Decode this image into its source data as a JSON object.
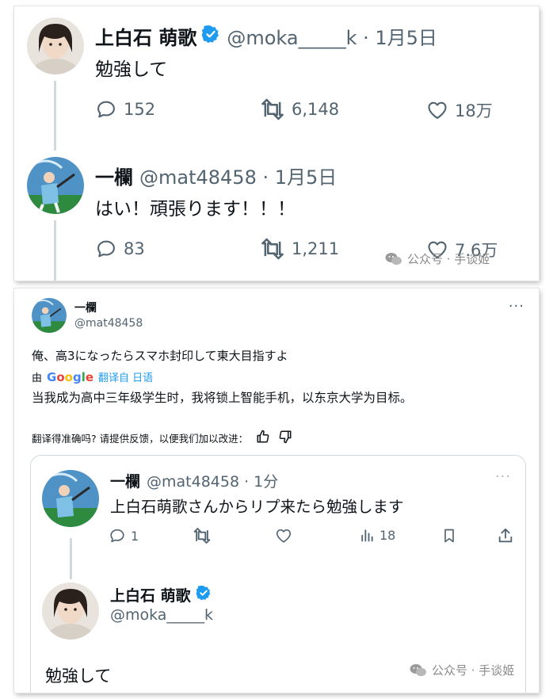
{
  "top_card": {
    "tweet1": {
      "name": "上白石 萌歌",
      "meta": "@moka_____k · 1月5日",
      "text": "勉強して",
      "replies": "152",
      "retweets": "6,148",
      "likes": "18万"
    },
    "tweet2": {
      "name": "一欄",
      "meta": "@mat48458 · 1月5日",
      "text": "はい！頑張ります！！！",
      "replies": "83",
      "retweets": "1,211",
      "likes": "7.6万"
    },
    "watermark": "公众号 · 手谈姬"
  },
  "bottom_card": {
    "name": "一欄",
    "handle": "@mat48458",
    "more": "···",
    "text": "俺、高3になったらスマホ封印して東大目指すよ",
    "by_prefix": "由",
    "google": {
      "G": "G",
      "o1": "o",
      "o2": "o",
      "g": "g",
      "l": "l",
      "e": "e"
    },
    "translated_from": "翻译自 日语",
    "translation": "当我成为高中三年级学生时，我将锁上智能手机，以东京大学为目标。",
    "feedback_prompt": "翻译得准确吗? 请提供反馈，以便我们加以改进：",
    "quote": {
      "name": "一欄",
      "meta": "@mat48458 · 1分",
      "more": "···",
      "text": "上白石萌歌さんからリプ来たら勉強します",
      "replies": "1",
      "views": "18",
      "reply_name": "上白石 萌歌",
      "reply_handle": "@moka_____k",
      "reply_text": "勉強して"
    },
    "watermark": "公众号 · 手谈姬"
  },
  "colors": {
    "verified": "#1d9bf0",
    "muted": "#536471",
    "link": "#1d9bf0"
  }
}
